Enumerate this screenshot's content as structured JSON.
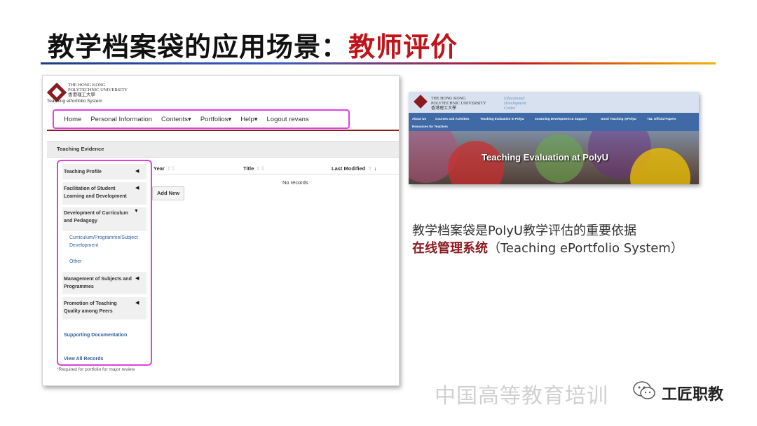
{
  "slide": {
    "title_main": "教学档案袋的应用场景：",
    "title_accent": "教师评价",
    "description_line1": "教学档案袋是PolyU教学评估的重要依据",
    "description_accent": "在线管理系统",
    "description_rest": "（Teaching ePortfolio System）",
    "watermark": "中国高等教育培训",
    "brand": "工匠职教",
    "colors": {
      "accent": "#c0141b",
      "highlight_border": "#e040e0",
      "university_maroon": "#8b1a1f"
    }
  },
  "eportfolio": {
    "university_line1": "THE HONG KONG",
    "university_line2": "POLYTECHNIC UNIVERSITY",
    "university_chinese": "香港理工大學",
    "system_name": "Teaching ePortfolio System",
    "nav": [
      "Home",
      "Personal Information",
      "Contents▾",
      "Portfolios▾",
      "Help▾",
      "Logout revans"
    ],
    "section_title": "Teaching Evidence",
    "sidebar": {
      "teaching_profile": "Teaching Profile",
      "facilitation": "Facilitation of Student Learning and Development",
      "development": "Development of Curriculum and Pedagogy",
      "curriculum_sub": "Curriculum/Programme/Subject Development",
      "other": "Other",
      "management": "Management of Subjects and Programmes",
      "promotion": "Promotion of Teaching Quality among Peers",
      "supporting": "Supporting Documentation",
      "view_all": "View All Records"
    },
    "table": {
      "col_year": "Year",
      "col_title": "Title",
      "col_modified": "Last Modified",
      "empty": "No records",
      "add_button": "Add New"
    },
    "footnote": "*Required for portfolio for major review"
  },
  "banner": {
    "university_line1": "THE HONG KONG",
    "university_line2": "POLYTECHNIC UNIVERSITY",
    "university_chinese": "香港理工大學",
    "edc_line1": "Educational",
    "edc_line2": "Development",
    "edc_line3": "Centre",
    "menu": [
      "About Us",
      "Courses and Activities",
      "Teaching Evaluation in PolyU",
      "eLearning Development & Support",
      "Good Teaching @PolyU",
      "T&L Official Papers",
      "Resources for Teachers"
    ],
    "caption": "Teaching Evaluation at PolyU"
  }
}
